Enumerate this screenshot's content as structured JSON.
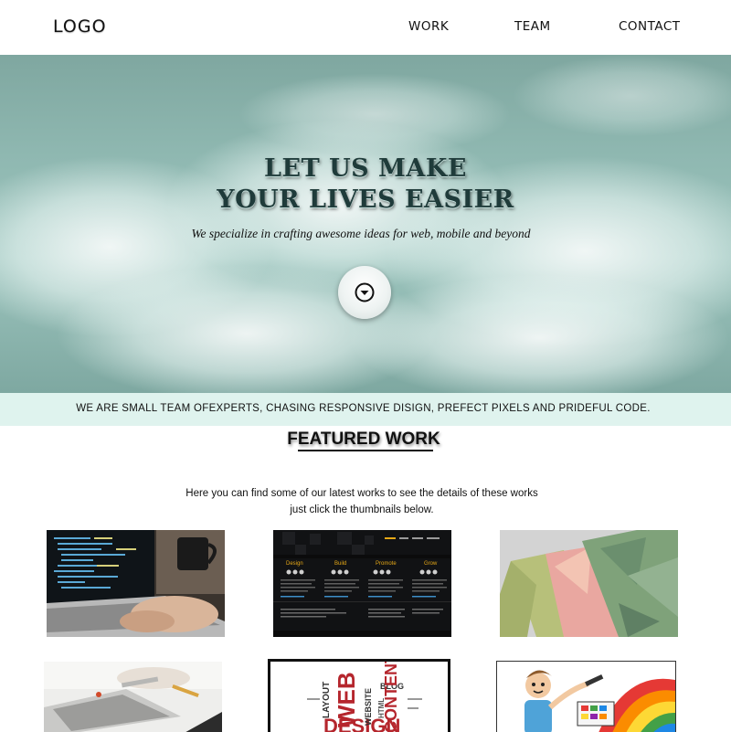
{
  "header": {
    "logo": "LOGO",
    "nav": [
      "WORK",
      "TEAM",
      "CONTACT"
    ]
  },
  "hero": {
    "title_line1": "LET US MAKE",
    "title_line2": "YOUR LIVES EASIER",
    "subtitle": "We specialize in crafting awesome ideas for web, mobile and beyond",
    "scroll_icon": "chevron-down-circle-icon"
  },
  "band": {
    "text": "WE ARE SMALL TEAM OFEXPERTS, CHASING RESPONSIVE DISIGN, PREFECT PIXELS AND PRIDEFUL CODE."
  },
  "featured": {
    "title": "FEATURED WORK",
    "desc_line1": "Here you can find some of our latest works to see the details of these works",
    "desc_line2": "just click the thumbnails below."
  },
  "thumb2": {
    "cols": [
      "Design",
      "Build",
      "Promote",
      "Grow"
    ]
  },
  "thumb5": {
    "words": [
      "WEB",
      "DESIGN",
      "LAYOUT",
      "WEBSITE",
      "BLOG",
      "CONTENT",
      "HTML"
    ]
  },
  "colors": {
    "hero_teal": "#8fb8b1",
    "band_bg": "#dff3ee",
    "thumb2_accent": "#f2a900"
  }
}
